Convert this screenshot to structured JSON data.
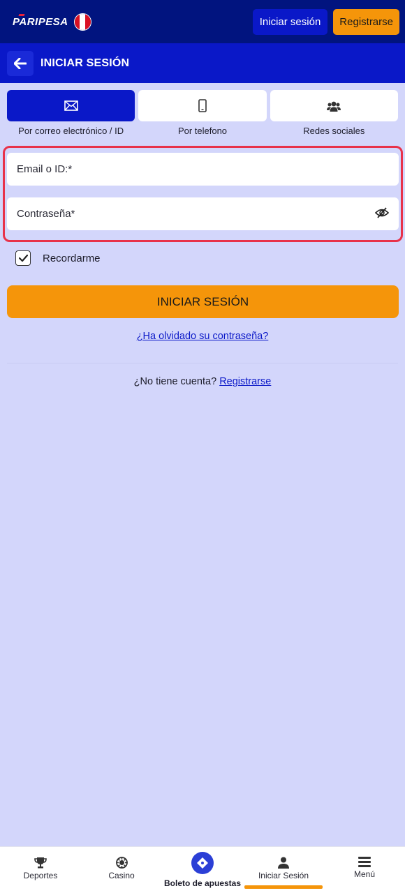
{
  "header": {
    "logo_text": "PARIPESA",
    "login_label": "Iniciar sesión",
    "register_label": "Registrarse"
  },
  "subheader": {
    "title": "INICIAR SESIÓN"
  },
  "tabs": [
    {
      "label": "Por correo electrónico / ID",
      "icon": "envelope-icon",
      "active": true
    },
    {
      "label": "Por telefono",
      "icon": "phone-icon",
      "active": false
    },
    {
      "label": "Redes sociales",
      "icon": "users-icon",
      "active": false
    }
  ],
  "form": {
    "email_placeholder": "Email o ID:*",
    "password_placeholder": "Contraseña*",
    "remember_label": "Recordarme",
    "remember_checked": true,
    "submit_label": "INICIAR SESIÓN",
    "forgot_link": "¿Ha olvidado su contraseña?",
    "no_account_text": "¿No tiene cuenta?",
    "register_link": "Registrarse"
  },
  "bottom_nav": [
    {
      "label": "Deportes",
      "icon": "trophy-icon"
    },
    {
      "label": "Casino",
      "icon": "casino-chip-icon"
    },
    {
      "label": "Boleto de apuestas",
      "icon": "ticket-icon"
    },
    {
      "label": "Iniciar Sesión",
      "icon": "user-icon",
      "active": true
    },
    {
      "label": "Menú",
      "icon": "menu-icon"
    }
  ],
  "colors": {
    "primary_dark": "#01147f",
    "primary": "#0a18c8",
    "accent": "#f5950a",
    "background": "#d3d6fb",
    "error_border": "#e8324a"
  }
}
